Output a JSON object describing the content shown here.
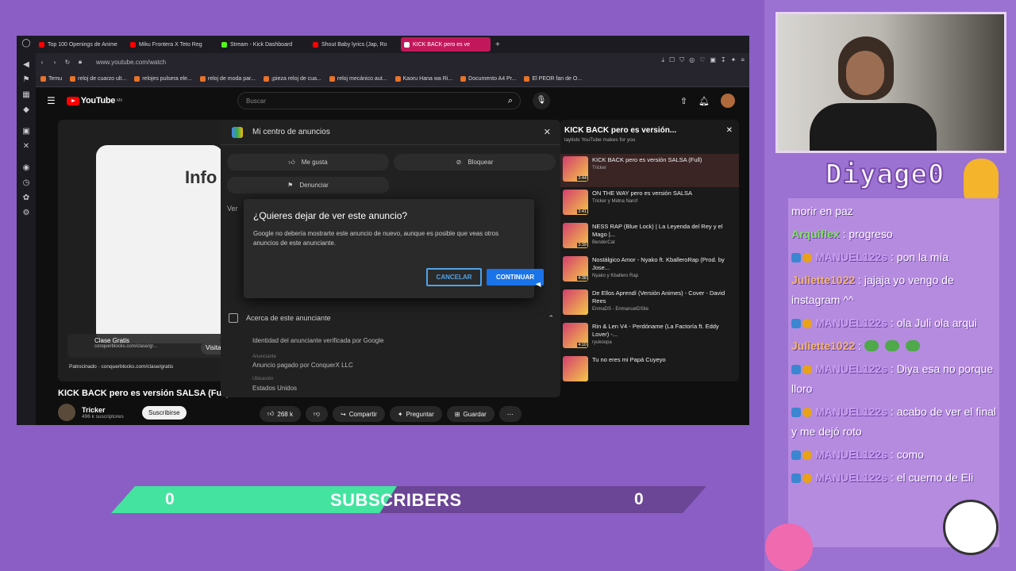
{
  "browser": {
    "tabs": [
      {
        "label": "Top 100 Openings de Anime",
        "color": "#ff0000"
      },
      {
        "label": "Miku Frontera X Teto Reg",
        "color": "#ff0000"
      },
      {
        "label": "Stream - Kick Dashboard",
        "color": "#53fc18"
      },
      {
        "label": "Shout Baby lyrics (Jap, Ro",
        "color": "#ff0000"
      },
      {
        "label": "KICK BACK pero es ve",
        "color": "#ffffff",
        "active": true
      }
    ],
    "url": "www.youtube.com/watch",
    "bookmarks": [
      "Temu",
      "reloj de cuarzo ult...",
      "relojes pulsera ele...",
      "reloj de moda par...",
      "¡pieza reloj de cua...",
      "reloj mecánico aut...",
      "Kaoru Hana wa Ri...",
      "Documento A4 Pr...",
      "El PEOR fan de O..."
    ]
  },
  "youtube": {
    "logo": "YouTube",
    "region": "MX",
    "search_placeholder": "Buscar",
    "video_title": "KICK BACK pero es versión SALSA (Full)",
    "channel_name": "Tricker",
    "channel_subs": "496 k suscriptores",
    "subscribe": "Suscribirse",
    "likes": "268 k",
    "actions": {
      "share": "Compartir",
      "ask": "Preguntar",
      "save": "Guardar"
    },
    "player": {
      "info_text": "Info",
      "ad_title": "Clase Gratis",
      "ad_url": "conquerblocks.com/clase/gr...",
      "visit": "Visitar siti",
      "sponsored": "Patrocinado",
      "sponsored_url": "conquerblocks.com/clase/gratis"
    },
    "playlist": {
      "title": "KICK BACK pero es versión...",
      "subtitle": "laylists YouTube makes for you",
      "items": [
        {
          "title": "KICK BACK pero es versión SALSA (Full)",
          "channel": "Tricker",
          "dur": "3:44"
        },
        {
          "title": "ON THE WAY pero es versión SALSA",
          "channel": "Tricker y Midna Narof",
          "dur": "3:41"
        },
        {
          "title": "NESS RAP (Blue Lock) | La Leyenda del Rey y el Mago |...",
          "channel": "BenderCat",
          "dur": "3:39"
        },
        {
          "title": "Nostálgico Amor - Nyako ft. KballeroRap (Prod. by Jose...",
          "channel": "Nyako y Kballero Rap",
          "dur": "4:38"
        },
        {
          "title": "De Ellos Aprendí (Versión Animes) - Cover - David Rees",
          "channel": "EnmaDS - EnmanuelDSite",
          "dur": ""
        },
        {
          "title": "Rin & Len V4 - Perdóname (La Factoría ft. Eddy Lover) -...",
          "channel": "ryukoopa",
          "dur": "4:10"
        },
        {
          "title": "Tu no eres mi Papá Cuyeyo",
          "channel": "",
          "dur": ""
        }
      ]
    }
  },
  "ad_center": {
    "title": "Mi centro de anuncios",
    "like": "Me gusta",
    "block": "Bloquear",
    "report": "Denunciar",
    "peek": "Ver",
    "about": "Acerca de este anunciante",
    "verified": "Identidad del anunciante verificada por Google",
    "advertiser_label": "Anunciante",
    "paid_by": "Anuncio pagado por ConquerX LLC",
    "location_label": "Ubicación",
    "location": "Estados Unidos"
  },
  "dialog": {
    "title": "¿Quieres dejar de ver este anuncio?",
    "body": "Google no debería mostrarte este anuncio de nuevo, aunque es posible que veas otros anuncios de este anunciante.",
    "cancel": "CANCELAR",
    "continue": "CONTINUAR"
  },
  "stream": {
    "channel_logo": "Diyage0",
    "subscribers_label": "SUBSCRIBERS",
    "sub_count_left": "0",
    "sub_count_right": "0",
    "sub_progress": 0.48,
    "chat": [
      {
        "user": "",
        "text": "morir en paz",
        "color": "#ffffff"
      },
      {
        "user": "Arquiflex",
        "text": " : progreso",
        "color": "#7fe35c"
      },
      {
        "user": "MANUEL122s",
        "text": " : pon la mía",
        "color": "#c9a0f0",
        "badges": true
      },
      {
        "user": "Juliette1022",
        "text": " : jajaja yo vengo de instagram ^^",
        "color": "#f2b86a"
      },
      {
        "user": "MANUEL122s",
        "text": " : ola Juli ola arqui",
        "color": "#c9a0f0",
        "badges": true
      },
      {
        "user": "Juliette1022",
        "text": " :",
        "color": "#f2b86a",
        "frogs": true
      },
      {
        "user": "MANUEL122s",
        "text": " : Diya esa no porque lloro",
        "color": "#c9a0f0",
        "badges": true
      },
      {
        "user": "MANUEL122s",
        "text": " : acabo de ver el final y me dejó roto",
        "color": "#c9a0f0",
        "badges": true
      },
      {
        "user": "MANUEL122s",
        "text": " : como",
        "color": "#c9a0f0",
        "badges": true
      },
      {
        "user": "MANUEL122s",
        "text": " : el cuerno de Eli",
        "color": "#c9a0f0",
        "badges": true
      }
    ]
  }
}
